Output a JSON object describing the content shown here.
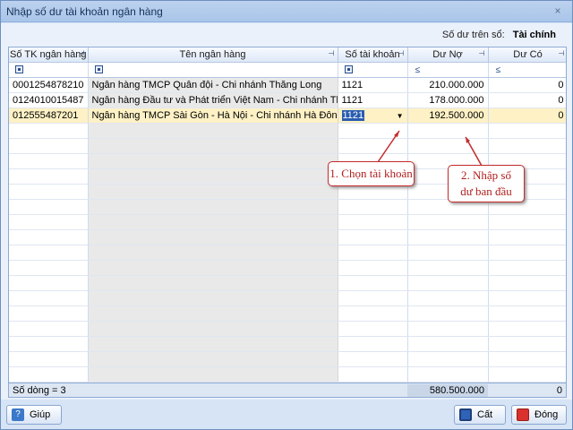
{
  "window": {
    "title": "Nhập số dư tài khoản ngân hàng",
    "close": "×"
  },
  "balance": {
    "label": "Số dư trên sổ:",
    "value": "Tài chính"
  },
  "columns": [
    "Số TK ngân hàng",
    "Tên ngân hàng",
    "Số tài khoản",
    "Dư Nợ",
    "Dư Có"
  ],
  "filter_symbols": {
    "le": "≤"
  },
  "rows": [
    {
      "account_no": "0001254878210",
      "bank": "Ngân hàng TMCP Quân đội - Chi nhánh Thăng Long",
      "account": "1121",
      "debit": "210.000.000",
      "credit": "0"
    },
    {
      "account_no": "0124010015487",
      "bank": "Ngân hàng Đầu tư và Phát triển Việt Nam - Chi nhánh Thanh Xuân",
      "account": "1121",
      "debit": "178.000.000",
      "credit": "0"
    },
    {
      "account_no": "012555487201",
      "bank": "Ngân hàng TMCP  Sài Gòn - Hà Nội - Chi nhánh Hà Đông",
      "account": "1121",
      "debit": "192.500.000",
      "credit": "0"
    }
  ],
  "footer": {
    "row_count": "Số dòng = 3",
    "debit_total": "580.500.000",
    "credit_total": "0"
  },
  "callouts": {
    "choose_account": "1. Chọn tài khoản",
    "enter_balance_line1": "2. Nhập số",
    "enter_balance_line2": "dư ban đầu"
  },
  "buttons": {
    "help": "Giúp",
    "save": "Cất",
    "close": "Đóng"
  },
  "colors": {
    "accent": "#2a5db0",
    "callout": "#c42b2b",
    "selected_row": "#fdf1c5"
  }
}
